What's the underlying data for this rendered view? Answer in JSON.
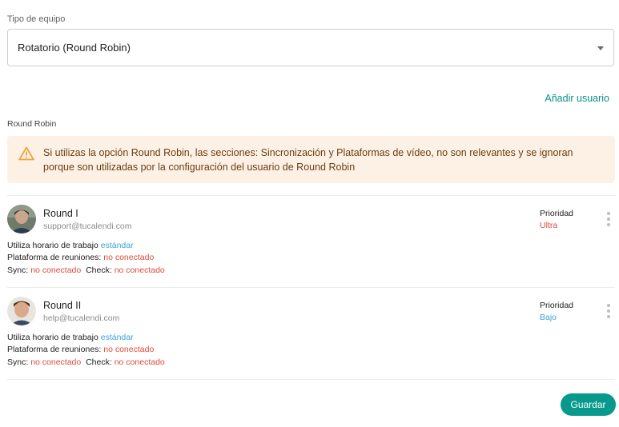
{
  "team_type": {
    "label": "Tipo de equipo",
    "selected": "Rotatorio (Round Robin)"
  },
  "add_user_label": "Añadir usuario",
  "section_label": "Round Robin",
  "alert": {
    "icon": "warning-triangle-icon",
    "line1": "Si utilizas la opción Round Robin, las secciones: Sincronización y Plataformas de vídeo, no son relevantes y se ignoran",
    "line2": "porque son utilizadas por la configuración del usuario de Round Robin"
  },
  "members": [
    {
      "name": "Round I",
      "email": "support@tucalendi.com",
      "schedule_label": "Utiliza horario de trabajo",
      "schedule_value": "estándar",
      "platform_label": "Plataforma de reuniones:",
      "platform_value": "no conectado",
      "sync_label": "Sync:",
      "sync_value": "no conectado",
      "check_label": "Check:",
      "check_value": "no conectado",
      "priority_label": "Prioridad",
      "priority_value": "Ultra",
      "priority_color": "#dc4a3d"
    },
    {
      "name": "Round II",
      "email": "help@tucalendi.com",
      "schedule_label": "Utiliza horario de trabajo",
      "schedule_value": "estándar",
      "platform_label": "Plataforma de reuniones:",
      "platform_value": "no conectado",
      "sync_label": "Sync:",
      "sync_value": "no conectado",
      "check_label": "Check:",
      "check_value": "no conectado",
      "priority_label": "Prioridad",
      "priority_value": "Bajo",
      "priority_color": "#3aa3d6"
    }
  ],
  "save_label": "Guardar",
  "colors": {
    "accent": "#06998c",
    "link": "#3aa3d6",
    "error": "#dc4a3d",
    "warning_bg": "#fdf1e6"
  }
}
